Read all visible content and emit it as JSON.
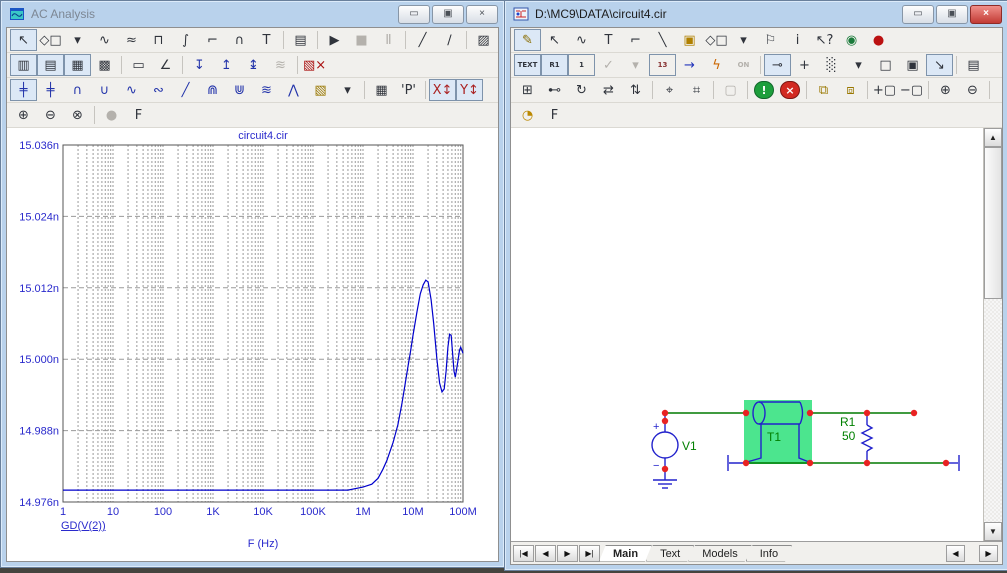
{
  "icons": {
    "minimize": "▭",
    "restore": "▣",
    "close": "×",
    "scroll_up": "▲",
    "scroll_down": "▼",
    "scroll_left": "◀",
    "scroll_right": "▶",
    "nav_first": "|◀",
    "nav_prev": "◀",
    "nav_next": "▶",
    "nav_last": "▶|"
  },
  "colors": {
    "wire": "#007a00",
    "component": "#2222cc",
    "label": "#008000",
    "node": "#e82222",
    "selection": "#4ce58e",
    "curve": "#0000cc",
    "axis_text": "#2a2acc",
    "grid": "#9a9a9a",
    "frame": "#555555"
  },
  "left_window": {
    "title": "AC Analysis",
    "toolbar1": [
      {
        "name": "select-tool",
        "glyph": "↖",
        "state": "selected"
      },
      {
        "name": "graphics-shapes",
        "glyph": "◇□"
      },
      {
        "name": "graphics-shapes-dropdown",
        "glyph": "▾"
      },
      {
        "name": "scale-mode",
        "glyph": "∿"
      },
      {
        "name": "cursor-mode",
        "glyph": "≈"
      },
      {
        "name": "horizontal-tag-mode",
        "glyph": "⊓"
      },
      {
        "name": "vertical-tag-mode",
        "glyph": "∫"
      },
      {
        "name": "tag-level-mode",
        "glyph": "⌐"
      },
      {
        "name": "frequency-tag-mode",
        "glyph": "∩"
      },
      {
        "name": "text-mode",
        "glyph": "T"
      },
      {
        "sep": true
      },
      {
        "name": "properties",
        "glyph": "▤"
      },
      {
        "sep": true
      },
      {
        "name": "run",
        "glyph": "▶"
      },
      {
        "name": "stop",
        "glyph": "■",
        "state": "disabled"
      },
      {
        "name": "pause",
        "glyph": "Ⅱ",
        "state": "disabled"
      },
      {
        "sep": true
      },
      {
        "name": "line-mode",
        "glyph": "╱"
      },
      {
        "name": "polyline-mode",
        "glyph": "∕"
      },
      {
        "sep": true
      },
      {
        "name": "select-region",
        "glyph": "▨"
      },
      {
        "name": "data-grid",
        "glyph": "▦"
      }
    ],
    "toolbar2": [
      {
        "name": "vertical-gridlines",
        "glyph": "▥",
        "state": "selected"
      },
      {
        "name": "horizontal-gridlines",
        "glyph": "▤",
        "state": "selected"
      },
      {
        "name": "grid-both",
        "glyph": "▦",
        "state": "selected"
      },
      {
        "name": "grid-minor",
        "glyph": "▩"
      },
      {
        "sep": true
      },
      {
        "name": "tracker-box",
        "glyph": "▭"
      },
      {
        "name": "tracker-slope",
        "glyph": "∠"
      },
      {
        "sep": true
      },
      {
        "name": "cursor-next-point",
        "glyph": "↧",
        "color": "#2233aa"
      },
      {
        "name": "cursor-same-point",
        "glyph": "↥",
        "color": "#2233aa"
      },
      {
        "name": "cursor-branch",
        "glyph": "↨",
        "color": "#2233aa"
      },
      {
        "name": "waveform-buffer",
        "glyph": "≋",
        "state": "disabled"
      },
      {
        "sep": true
      },
      {
        "name": "exit-analysis",
        "glyph": "▧×",
        "color": "#aa1111"
      }
    ],
    "toolbar3": [
      {
        "name": "go-left-cursor",
        "glyph": "╪",
        "state": "selected",
        "color": "#2233aa"
      },
      {
        "name": "go-right-cursor",
        "glyph": "╪",
        "color": "#2233aa"
      },
      {
        "name": "peak-cursor",
        "glyph": "∩",
        "color": "#2233aa"
      },
      {
        "name": "valley-cursor",
        "glyph": "∪",
        "color": "#2233aa"
      },
      {
        "name": "high-cursor",
        "glyph": "∿",
        "color": "#2233aa"
      },
      {
        "name": "low-cursor",
        "glyph": "∾",
        "color": "#2233aa"
      },
      {
        "name": "inflection-cursor",
        "glyph": "╱",
        "color": "#2233aa"
      },
      {
        "name": "global-high-cursor",
        "glyph": "⋒",
        "color": "#2233aa"
      },
      {
        "name": "global-low-cursor",
        "glyph": "⋓",
        "color": "#2233aa"
      },
      {
        "name": "envelope-cursor",
        "glyph": "≋",
        "color": "#2233aa"
      },
      {
        "name": "top-cursor",
        "glyph": "⋀",
        "color": "#2233aa"
      },
      {
        "name": "waveform-options",
        "glyph": "▧",
        "color": "#997700"
      },
      {
        "name": "waveform-options-dropdown",
        "glyph": "▾"
      },
      {
        "sep": true
      },
      {
        "name": "numeric-output",
        "glyph": "▦"
      },
      {
        "name": "p-key",
        "glyph": "'P'"
      },
      {
        "sep": true
      },
      {
        "name": "x-scale-format",
        "glyph": "X↕",
        "state": "selected",
        "color": "#aa2222"
      },
      {
        "name": "y-scale-format",
        "glyph": "Y↕",
        "state": "selected",
        "color": "#aa2222"
      }
    ],
    "toolbar4": [
      {
        "name": "zoom-in",
        "glyph": "⊕"
      },
      {
        "name": "zoom-out",
        "glyph": "⊖"
      },
      {
        "name": "zoom-region",
        "glyph": "⊗"
      },
      {
        "sep": true
      },
      {
        "name": "3d-view",
        "glyph": "●",
        "state": "disabled"
      },
      {
        "name": "font",
        "glyph": "F"
      }
    ]
  },
  "chart_data": {
    "type": "line",
    "title": "circuit4.cir",
    "xlabel": "F (Hz)",
    "ylabel": "",
    "x_scale": "log",
    "xlim": [
      1,
      100000000
    ],
    "ylim_ns": [
      14.976,
      15.036
    ],
    "x_ticks": [
      "1",
      "10",
      "100",
      "1K",
      "10K",
      "100K",
      "1M",
      "10M",
      "100M"
    ],
    "y_ticks": [
      "15.036n",
      "15.024n",
      "15.012n",
      "15.000n",
      "14.988n",
      "14.976n"
    ],
    "grid": "dashed",
    "legend_position": "bottom-left",
    "series": [
      {
        "name": "GD(V(2))",
        "x": [
          1,
          10,
          100,
          1000,
          10000,
          100000,
          500000,
          1000000,
          1500000,
          2000000,
          2500000,
          3000000,
          4000000,
          5000000,
          6000000,
          7000000,
          8000000,
          9000000,
          10000000,
          12000000,
          14000000,
          16000000,
          18000000,
          20000000,
          23000000,
          26000000,
          30000000,
          34000000,
          38000000,
          42000000,
          46000000,
          50000000,
          54000000,
          58000000,
          62000000,
          66000000,
          70000000,
          75000000,
          80000000,
          85000000,
          90000000,
          95000000,
          100000000
        ],
        "y_ns": [
          14.978,
          14.978,
          14.978,
          14.978,
          14.978,
          14.978,
          14.978,
          14.9785,
          14.979,
          14.98,
          14.9815,
          14.983,
          14.986,
          14.989,
          14.9925,
          14.996,
          14.999,
          15.0015,
          15.004,
          15.008,
          15.011,
          15.0125,
          15.0133,
          15.013,
          15.01,
          15.006,
          15.0,
          14.996,
          14.9945,
          14.995,
          14.998,
          15.002,
          15.0042,
          15.004,
          15.001,
          14.998,
          14.997,
          14.9985,
          15.0,
          15.0015,
          15.002,
          15.0015,
          15.001
        ]
      }
    ]
  },
  "right_window": {
    "title": "D:\\MC9\\DATA\\circuit4.cir",
    "toolbar1": [
      {
        "name": "wire-mode",
        "glyph": "✎",
        "state": "selected",
        "color": "#8a6d00"
      },
      {
        "name": "select-mode",
        "glyph": "↖"
      },
      {
        "name": "component-mode",
        "glyph": "∿"
      },
      {
        "name": "text-mode",
        "glyph": "T"
      },
      {
        "name": "wire-orthogonal-mode",
        "glyph": "⌐"
      },
      {
        "name": "line-mode",
        "glyph": "╲"
      },
      {
        "name": "bus-mode",
        "glyph": "▣",
        "color": "#b08000"
      },
      {
        "name": "graphics-shapes",
        "glyph": "◇□"
      },
      {
        "name": "graphics-shapes-dropdown",
        "glyph": "▾"
      },
      {
        "name": "flag-mode",
        "glyph": "⚐"
      },
      {
        "name": "info-mode",
        "glyph": "i"
      },
      {
        "name": "help-mode",
        "glyph": "↖?"
      },
      {
        "name": "web-page",
        "glyph": "◉",
        "color": "#1a7a3a"
      },
      {
        "name": "error-indicator",
        "glyph": "●",
        "color": "#bb1111"
      }
    ],
    "toolbar2": [
      {
        "name": "text-display-toggle",
        "glyph": "TEXT",
        "small": true,
        "state": "selected",
        "boxed": true
      },
      {
        "name": "attribute-display-toggle",
        "glyph": "R1",
        "small": true,
        "state": "selected"
      },
      {
        "name": "node-numbers-toggle",
        "glyph": "1",
        "boxed": true,
        "small": true
      },
      {
        "name": "vip-display",
        "glyph": "✓",
        "state": "disabled"
      },
      {
        "name": "vip-dropdown",
        "glyph": "▾",
        "state": "disabled"
      },
      {
        "name": "pin-numbers-toggle",
        "glyph": "13",
        "boxed": true,
        "small": true,
        "color": "#883333"
      },
      {
        "name": "current-display",
        "glyph": "→",
        "color": "#2233bb"
      },
      {
        "name": "power-display",
        "glyph": "ϟ",
        "color": "#cc6600"
      },
      {
        "name": "condition-display",
        "glyph": "ON",
        "small": true,
        "state": "disabled"
      },
      {
        "sep": true
      },
      {
        "name": "node-snap-toggle",
        "glyph": "⊸",
        "state": "selected"
      },
      {
        "name": "crosshair-cursor-toggle",
        "glyph": "+"
      },
      {
        "name": "grid-toggle",
        "glyph": "░"
      },
      {
        "name": "grid-dropdown",
        "glyph": "▾"
      },
      {
        "name": "border-toggle",
        "glyph": "□"
      },
      {
        "name": "title-block-toggle",
        "glyph": "▣"
      },
      {
        "name": "mouse-info-toggle",
        "glyph": "↘",
        "state": "selected"
      },
      {
        "sep": true
      },
      {
        "name": "properties",
        "glyph": "▤"
      }
    ],
    "toolbar3": [
      {
        "name": "pan-tool",
        "glyph": "⊞"
      },
      {
        "name": "connector-tool",
        "glyph": "⊷"
      },
      {
        "name": "rotate-tool",
        "glyph": "↻"
      },
      {
        "name": "flip-horizontal",
        "glyph": "⇄"
      },
      {
        "name": "flip-vertical",
        "glyph": "⇅"
      },
      {
        "sep": true
      },
      {
        "name": "find-component",
        "glyph": "⌖"
      },
      {
        "name": "find",
        "glyph": "⌗"
      },
      {
        "sep": true
      },
      {
        "name": "pcb-view",
        "glyph": "▢",
        "state": "disabled"
      },
      {
        "sep": true
      },
      {
        "name": "info-status",
        "glyph": "!",
        "badge": "green"
      },
      {
        "name": "error-status",
        "glyph": "×",
        "badge": "red"
      },
      {
        "sep": true
      },
      {
        "name": "bring-to-front",
        "glyph": "⧉",
        "color": "#997700"
      },
      {
        "name": "send-to-back",
        "glyph": "⧈",
        "color": "#997700"
      },
      {
        "sep": true
      },
      {
        "name": "add-page",
        "glyph": "+▢"
      },
      {
        "name": "remove-page",
        "glyph": "−▢"
      },
      {
        "sep": true
      },
      {
        "name": "zoom-in",
        "glyph": "⊕"
      },
      {
        "name": "zoom-out",
        "glyph": "⊖"
      },
      {
        "sep": true
      },
      {
        "name": "flag-list",
        "glyph": "⚐",
        "state": "disabled"
      },
      {
        "name": "flag-dropdown",
        "glyph": "▾",
        "state": "disabled"
      },
      {
        "sep": true
      },
      {
        "name": "snapshot",
        "glyph": "▣",
        "state": "disabled"
      }
    ],
    "toolbar4": [
      {
        "name": "color-palette",
        "glyph": "◔",
        "color": "#bb8800"
      },
      {
        "name": "font",
        "glyph": "F"
      }
    ],
    "schematic": {
      "components": [
        {
          "ref": "V1"
        },
        {
          "ref": "T1",
          "selected": true
        },
        {
          "ref": "R1",
          "value": "50"
        }
      ],
      "plus_sign": "+",
      "minus_sign": "−"
    },
    "tabs": [
      "Main",
      "Text",
      "Models",
      "Info"
    ],
    "selected_tab": "Main"
  }
}
